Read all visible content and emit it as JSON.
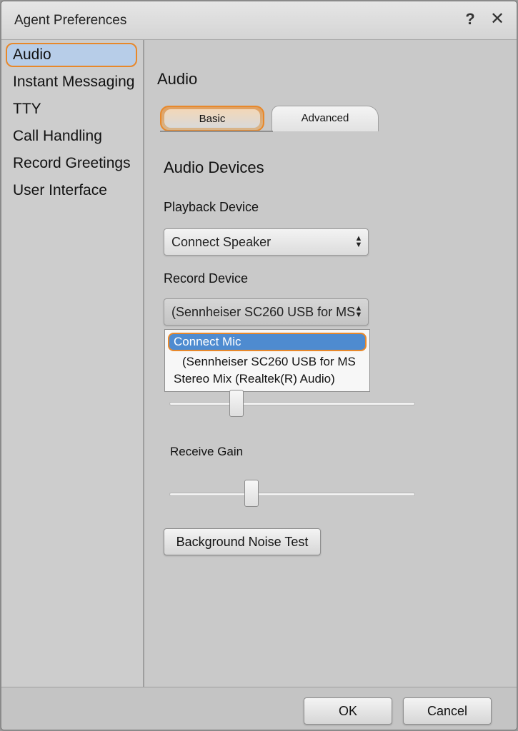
{
  "window": {
    "title": "Agent Preferences",
    "help_icon": "?",
    "close_icon": "✕"
  },
  "sidebar": {
    "items": [
      {
        "label": "Audio",
        "selected": true
      },
      {
        "label": "Instant Messaging",
        "selected": false
      },
      {
        "label": "TTY",
        "selected": false
      },
      {
        "label": "Call Handling",
        "selected": false
      },
      {
        "label": "Record Greetings",
        "selected": false
      },
      {
        "label": "User Interface",
        "selected": false
      }
    ]
  },
  "main": {
    "section_title": "Audio",
    "tabs": [
      {
        "label": "Basic",
        "active": true
      },
      {
        "label": "Advanced",
        "active": false
      }
    ],
    "group_title": "Audio Devices",
    "playback": {
      "label": "Playback Device",
      "value": "Connect Speaker"
    },
    "record": {
      "label": "Record Device",
      "value": "(Sennheiser SC260 USB for MS",
      "options": [
        {
          "label": "Connect Mic",
          "highlighted": true
        },
        {
          "label": "(Sennheiser SC260 USB for MS",
          "highlighted": false
        },
        {
          "label": "Stereo Mix (Realtek(R) Audio)",
          "highlighted": false
        }
      ]
    },
    "transmit_slider": {
      "level": 0.27
    },
    "receive_gain": {
      "label": "Receive Gain",
      "level": 0.33
    },
    "noise_test_label": "Background Noise Test"
  },
  "footer": {
    "ok_label": "OK",
    "cancel_label": "Cancel"
  },
  "colors": {
    "highlight_outline": "#e8882a",
    "selection_blue": "#4e8bd0",
    "sidebar_selected_bg": "#b7cde8"
  }
}
